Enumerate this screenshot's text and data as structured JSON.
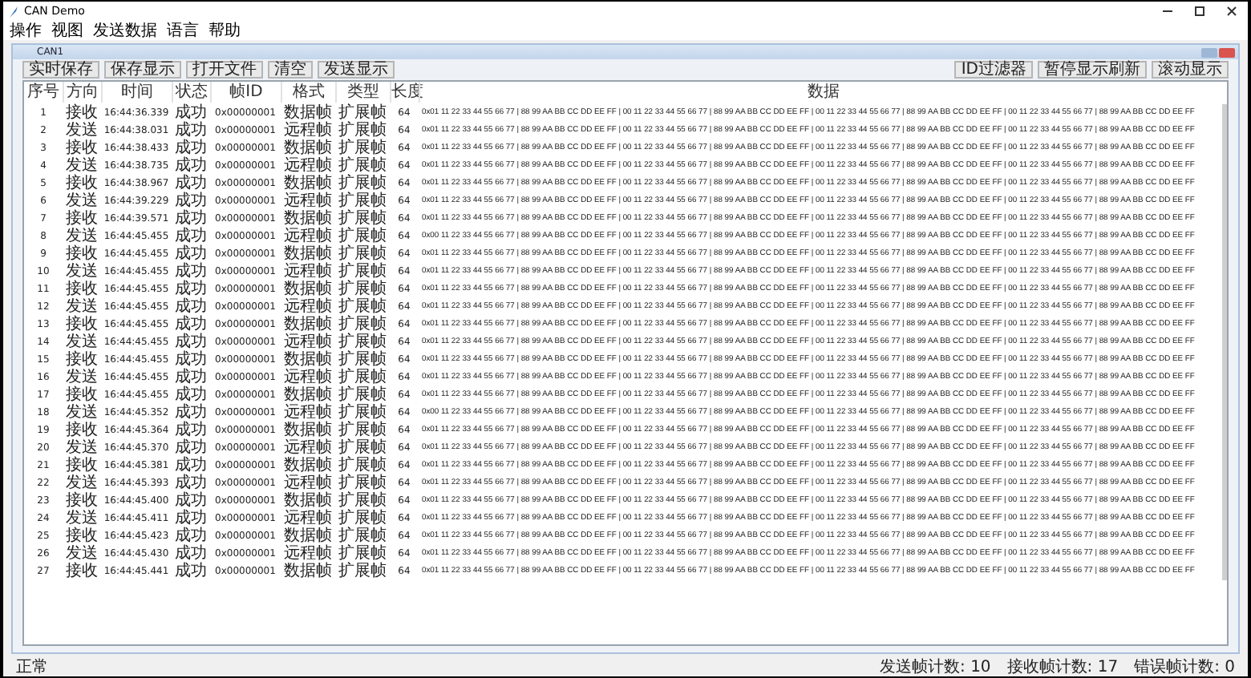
{
  "window": {
    "title": "CAN Demo"
  },
  "menu": [
    "操作",
    "视图",
    "发送数据",
    "语言",
    "帮助"
  ],
  "child_window": {
    "title": "CAN1"
  },
  "toolbar_left": [
    "实时保存",
    "保存显示",
    "打开文件",
    "清空",
    "发送显示"
  ],
  "toolbar_right": [
    "ID过滤器",
    "暂停显示刷新",
    "滚动显示"
  ],
  "table": {
    "columns": [
      "序号",
      "方向",
      "时间",
      "状态",
      "帧ID",
      "格式",
      "类型",
      "长度",
      "数据"
    ],
    "rows": [
      {
        "seq": "1",
        "direction": "接收",
        "time": "16:44:36.339",
        "status": "成功",
        "frame_id": "0x00000001",
        "format": "数据帧",
        "type": "扩展帧",
        "length": "64",
        "data": "0x01 11 22 33 44 55 66 77 | 88 99 AA BB CC DD EE FF | 00 11 22 33 44 55 66 77 | 88 99 AA BB CC DD EE FF | 00 11 22 33 44 55 66 77 | 88 99 AA BB CC DD EE FF | 00 11 22 33 44 55 66 77 | 88 99 AA BB CC DD EE FF"
      },
      {
        "seq": "2",
        "direction": "发送",
        "time": "16:44:38.031",
        "status": "成功",
        "frame_id": "0x00000001",
        "format": "远程帧",
        "type": "扩展帧",
        "length": "64",
        "data": "0x01 11 22 33 44 55 66 77 | 88 99 AA BB CC DD EE FF | 00 11 22 33 44 55 66 77 | 88 99 AA BB CC DD EE FF | 00 11 22 33 44 55 66 77 | 88 99 AA BB CC DD EE FF | 00 11 22 33 44 55 66 77 | 88 99 AA BB CC DD EE FF"
      },
      {
        "seq": "3",
        "direction": "接收",
        "time": "16:44:38.433",
        "status": "成功",
        "frame_id": "0x00000001",
        "format": "数据帧",
        "type": "扩展帧",
        "length": "64",
        "data": "0x01 11 22 33 44 55 66 77 | 88 99 AA BB CC DD EE FF | 00 11 22 33 44 55 66 77 | 88 99 AA BB CC DD EE FF | 00 11 22 33 44 55 66 77 | 88 99 AA BB CC DD EE FF | 00 11 22 33 44 55 66 77 | 88 99 AA BB CC DD EE FF"
      },
      {
        "seq": "4",
        "direction": "发送",
        "time": "16:44:38.735",
        "status": "成功",
        "frame_id": "0x00000001",
        "format": "远程帧",
        "type": "扩展帧",
        "length": "64",
        "data": "0x01 11 22 33 44 55 66 77 | 88 99 AA BB CC DD EE FF | 00 11 22 33 44 55 66 77 | 88 99 AA BB CC DD EE FF | 00 11 22 33 44 55 66 77 | 88 99 AA BB CC DD EE FF | 00 11 22 33 44 55 66 77 | 88 99 AA BB CC DD EE FF"
      },
      {
        "seq": "5",
        "direction": "接收",
        "time": "16:44:38.967",
        "status": "成功",
        "frame_id": "0x00000001",
        "format": "数据帧",
        "type": "扩展帧",
        "length": "64",
        "data": "0x01 11 22 33 44 55 66 77 | 88 99 AA BB CC DD EE FF | 00 11 22 33 44 55 66 77 | 88 99 AA BB CC DD EE FF | 00 11 22 33 44 55 66 77 | 88 99 AA BB CC DD EE FF | 00 11 22 33 44 55 66 77 | 88 99 AA BB CC DD EE FF"
      },
      {
        "seq": "6",
        "direction": "发送",
        "time": "16:44:39.229",
        "status": "成功",
        "frame_id": "0x00000001",
        "format": "远程帧",
        "type": "扩展帧",
        "length": "64",
        "data": "0x01 11 22 33 44 55 66 77 | 88 99 AA BB CC DD EE FF | 00 11 22 33 44 55 66 77 | 88 99 AA BB CC DD EE FF | 00 11 22 33 44 55 66 77 | 88 99 AA BB CC DD EE FF | 00 11 22 33 44 55 66 77 | 88 99 AA BB CC DD EE FF"
      },
      {
        "seq": "7",
        "direction": "接收",
        "time": "16:44:39.571",
        "status": "成功",
        "frame_id": "0x00000001",
        "format": "数据帧",
        "type": "扩展帧",
        "length": "64",
        "data": "0x01 11 22 33 44 55 66 77 | 88 99 AA BB CC DD EE FF | 00 11 22 33 44 55 66 77 | 88 99 AA BB CC DD EE FF | 00 11 22 33 44 55 66 77 | 88 99 AA BB CC DD EE FF | 00 11 22 33 44 55 66 77 | 88 99 AA BB CC DD EE FF"
      },
      {
        "seq": "8",
        "direction": "发送",
        "time": "16:44:45.455",
        "status": "成功",
        "frame_id": "0x00000001",
        "format": "远程帧",
        "type": "扩展帧",
        "length": "64",
        "data": "0x00 11 22 33 44 55 66 77 | 88 99 AA BB CC DD EE FF | 00 11 22 33 44 55 66 77 | 88 99 AA BB CC DD EE FF | 00 11 22 33 44 55 66 77 | 88 99 AA BB CC DD EE FF | 00 11 22 33 44 55 66 77 | 88 99 AA BB CC DD EE FF"
      },
      {
        "seq": "9",
        "direction": "接收",
        "time": "16:44:45.455",
        "status": "成功",
        "frame_id": "0x00000001",
        "format": "数据帧",
        "type": "扩展帧",
        "length": "64",
        "data": "0x01 11 22 33 44 55 66 77 | 88 99 AA BB CC DD EE FF | 00 11 22 33 44 55 66 77 | 88 99 AA BB CC DD EE FF | 00 11 22 33 44 55 66 77 | 88 99 AA BB CC DD EE FF | 00 11 22 33 44 55 66 77 | 88 99 AA BB CC DD EE FF"
      },
      {
        "seq": "10",
        "direction": "发送",
        "time": "16:44:45.455",
        "status": "成功",
        "frame_id": "0x00000001",
        "format": "远程帧",
        "type": "扩展帧",
        "length": "64",
        "data": "0x01 11 22 33 44 55 66 77 | 88 99 AA BB CC DD EE FF | 00 11 22 33 44 55 66 77 | 88 99 AA BB CC DD EE FF | 00 11 22 33 44 55 66 77 | 88 99 AA BB CC DD EE FF | 00 11 22 33 44 55 66 77 | 88 99 AA BB CC DD EE FF"
      },
      {
        "seq": "11",
        "direction": "接收",
        "time": "16:44:45.455",
        "status": "成功",
        "frame_id": "0x00000001",
        "format": "数据帧",
        "type": "扩展帧",
        "length": "64",
        "data": "0x01 11 22 33 44 55 66 77 | 88 99 AA BB CC DD EE FF | 00 11 22 33 44 55 66 77 | 88 99 AA BB CC DD EE FF | 00 11 22 33 44 55 66 77 | 88 99 AA BB CC DD EE FF | 00 11 22 33 44 55 66 77 | 88 99 AA BB CC DD EE FF"
      },
      {
        "seq": "12",
        "direction": "发送",
        "time": "16:44:45.455",
        "status": "成功",
        "frame_id": "0x00000001",
        "format": "远程帧",
        "type": "扩展帧",
        "length": "64",
        "data": "0x01 11 22 33 44 55 66 77 | 88 99 AA BB CC DD EE FF | 00 11 22 33 44 55 66 77 | 88 99 AA BB CC DD EE FF | 00 11 22 33 44 55 66 77 | 88 99 AA BB CC DD EE FF | 00 11 22 33 44 55 66 77 | 88 99 AA BB CC DD EE FF"
      },
      {
        "seq": "13",
        "direction": "接收",
        "time": "16:44:45.455",
        "status": "成功",
        "frame_id": "0x00000001",
        "format": "数据帧",
        "type": "扩展帧",
        "length": "64",
        "data": "0x01 11 22 33 44 55 66 77 | 88 99 AA BB CC DD EE FF | 00 11 22 33 44 55 66 77 | 88 99 AA BB CC DD EE FF | 00 11 22 33 44 55 66 77 | 88 99 AA BB CC DD EE FF | 00 11 22 33 44 55 66 77 | 88 99 AA BB CC DD EE FF"
      },
      {
        "seq": "14",
        "direction": "发送",
        "time": "16:44:45.455",
        "status": "成功",
        "frame_id": "0x00000001",
        "format": "远程帧",
        "type": "扩展帧",
        "length": "64",
        "data": "0x01 11 22 33 44 55 66 77 | 88 99 AA BB CC DD EE FF | 00 11 22 33 44 55 66 77 | 88 99 AA BB CC DD EE FF | 00 11 22 33 44 55 66 77 | 88 99 AA BB CC DD EE FF | 00 11 22 33 44 55 66 77 | 88 99 AA BB CC DD EE FF"
      },
      {
        "seq": "15",
        "direction": "接收",
        "time": "16:44:45.455",
        "status": "成功",
        "frame_id": "0x00000001",
        "format": "数据帧",
        "type": "扩展帧",
        "length": "64",
        "data": "0x01 11 22 33 44 55 66 77 | 88 99 AA BB CC DD EE FF | 00 11 22 33 44 55 66 77 | 88 99 AA BB CC DD EE FF | 00 11 22 33 44 55 66 77 | 88 99 AA BB CC DD EE FF | 00 11 22 33 44 55 66 77 | 88 99 AA BB CC DD EE FF"
      },
      {
        "seq": "16",
        "direction": "发送",
        "time": "16:44:45.455",
        "status": "成功",
        "frame_id": "0x00000001",
        "format": "远程帧",
        "type": "扩展帧",
        "length": "64",
        "data": "0x01 11 22 33 44 55 66 77 | 88 99 AA BB CC DD EE FF | 00 11 22 33 44 55 66 77 | 88 99 AA BB CC DD EE FF | 00 11 22 33 44 55 66 77 | 88 99 AA BB CC DD EE FF | 00 11 22 33 44 55 66 77 | 88 99 AA BB CC DD EE FF"
      },
      {
        "seq": "17",
        "direction": "接收",
        "time": "16:44:45.455",
        "status": "成功",
        "frame_id": "0x00000001",
        "format": "数据帧",
        "type": "扩展帧",
        "length": "64",
        "data": "0x01 11 22 33 44 55 66 77 | 88 99 AA BB CC DD EE FF | 00 11 22 33 44 55 66 77 | 88 99 AA BB CC DD EE FF | 00 11 22 33 44 55 66 77 | 88 99 AA BB CC DD EE FF | 00 11 22 33 44 55 66 77 | 88 99 AA BB CC DD EE FF"
      },
      {
        "seq": "18",
        "direction": "发送",
        "time": "16:44:45.352",
        "status": "成功",
        "frame_id": "0x00000001",
        "format": "远程帧",
        "type": "扩展帧",
        "length": "64",
        "data": "0x00 11 22 33 44 55 66 77 | 88 99 AA BB CC DD EE FF | 00 11 22 33 44 55 66 77 | 88 99 AA BB CC DD EE FF | 00 11 22 33 44 55 66 77 | 88 99 AA BB CC DD EE FF | 00 11 22 33 44 55 66 77 | 88 99 AA BB CC DD EE FF"
      },
      {
        "seq": "19",
        "direction": "接收",
        "time": "16:44:45.364",
        "status": "成功",
        "frame_id": "0x00000001",
        "format": "数据帧",
        "type": "扩展帧",
        "length": "64",
        "data": "0x01 11 22 33 44 55 66 77 | 88 99 AA BB CC DD EE FF | 00 11 22 33 44 55 66 77 | 88 99 AA BB CC DD EE FF | 00 11 22 33 44 55 66 77 | 88 99 AA BB CC DD EE FF | 00 11 22 33 44 55 66 77 | 88 99 AA BB CC DD EE FF"
      },
      {
        "seq": "20",
        "direction": "发送",
        "time": "16:44:45.370",
        "status": "成功",
        "frame_id": "0x00000001",
        "format": "远程帧",
        "type": "扩展帧",
        "length": "64",
        "data": "0x01 11 22 33 44 55 66 77 | 88 99 AA BB CC DD EE FF | 00 11 22 33 44 55 66 77 | 88 99 AA BB CC DD EE FF | 00 11 22 33 44 55 66 77 | 88 99 AA BB CC DD EE FF | 00 11 22 33 44 55 66 77 | 88 99 AA BB CC DD EE FF"
      },
      {
        "seq": "21",
        "direction": "接收",
        "time": "16:44:45.381",
        "status": "成功",
        "frame_id": "0x00000001",
        "format": "数据帧",
        "type": "扩展帧",
        "length": "64",
        "data": "0x01 11 22 33 44 55 66 77 | 88 99 AA BB CC DD EE FF | 00 11 22 33 44 55 66 77 | 88 99 AA BB CC DD EE FF | 00 11 22 33 44 55 66 77 | 88 99 AA BB CC DD EE FF | 00 11 22 33 44 55 66 77 | 88 99 AA BB CC DD EE FF"
      },
      {
        "seq": "22",
        "direction": "发送",
        "time": "16:44:45.393",
        "status": "成功",
        "frame_id": "0x00000001",
        "format": "远程帧",
        "type": "扩展帧",
        "length": "64",
        "data": "0x01 11 22 33 44 55 66 77 | 88 99 AA BB CC DD EE FF | 00 11 22 33 44 55 66 77 | 88 99 AA BB CC DD EE FF | 00 11 22 33 44 55 66 77 | 88 99 AA BB CC DD EE FF | 00 11 22 33 44 55 66 77 | 88 99 AA BB CC DD EE FF"
      },
      {
        "seq": "23",
        "direction": "接收",
        "time": "16:44:45.400",
        "status": "成功",
        "frame_id": "0x00000001",
        "format": "数据帧",
        "type": "扩展帧",
        "length": "64",
        "data": "0x01 11 22 33 44 55 66 77 | 88 99 AA BB CC DD EE FF | 00 11 22 33 44 55 66 77 | 88 99 AA BB CC DD EE FF | 00 11 22 33 44 55 66 77 | 88 99 AA BB CC DD EE FF | 00 11 22 33 44 55 66 77 | 88 99 AA BB CC DD EE FF"
      },
      {
        "seq": "24",
        "direction": "发送",
        "time": "16:44:45.411",
        "status": "成功",
        "frame_id": "0x00000001",
        "format": "远程帧",
        "type": "扩展帧",
        "length": "64",
        "data": "0x01 11 22 33 44 55 66 77 | 88 99 AA BB CC DD EE FF | 00 11 22 33 44 55 66 77 | 88 99 AA BB CC DD EE FF | 00 11 22 33 44 55 66 77 | 88 99 AA BB CC DD EE FF | 00 11 22 33 44 55 66 77 | 88 99 AA BB CC DD EE FF"
      },
      {
        "seq": "25",
        "direction": "接收",
        "time": "16:44:45.423",
        "status": "成功",
        "frame_id": "0x00000001",
        "format": "数据帧",
        "type": "扩展帧",
        "length": "64",
        "data": "0x01 11 22 33 44 55 66 77 | 88 99 AA BB CC DD EE FF | 00 11 22 33 44 55 66 77 | 88 99 AA BB CC DD EE FF | 00 11 22 33 44 55 66 77 | 88 99 AA BB CC DD EE FF | 00 11 22 33 44 55 66 77 | 88 99 AA BB CC DD EE FF"
      },
      {
        "seq": "26",
        "direction": "发送",
        "time": "16:44:45.430",
        "status": "成功",
        "frame_id": "0x00000001",
        "format": "远程帧",
        "type": "扩展帧",
        "length": "64",
        "data": "0x01 11 22 33 44 55 66 77 | 88 99 AA BB CC DD EE FF | 00 11 22 33 44 55 66 77 | 88 99 AA BB CC DD EE FF | 00 11 22 33 44 55 66 77 | 88 99 AA BB CC DD EE FF | 00 11 22 33 44 55 66 77 | 88 99 AA BB CC DD EE FF"
      },
      {
        "seq": "27",
        "direction": "接收",
        "time": "16:44:45.441",
        "status": "成功",
        "frame_id": "0x00000001",
        "format": "数据帧",
        "type": "扩展帧",
        "length": "64",
        "data": "0x01 11 22 33 44 55 66 77 | 88 99 AA BB CC DD EE FF | 00 11 22 33 44 55 66 77 | 88 99 AA BB CC DD EE FF | 00 11 22 33 44 55 66 77 | 88 99 AA BB CC DD EE FF | 00 11 22 33 44 55 66 77 | 88 99 AA BB CC DD EE FF"
      }
    ]
  },
  "status_bar": {
    "state": "正常",
    "counters": [
      "发送帧计数: 10",
      "接收帧计数: 17",
      "错误帧计数: 0"
    ]
  }
}
